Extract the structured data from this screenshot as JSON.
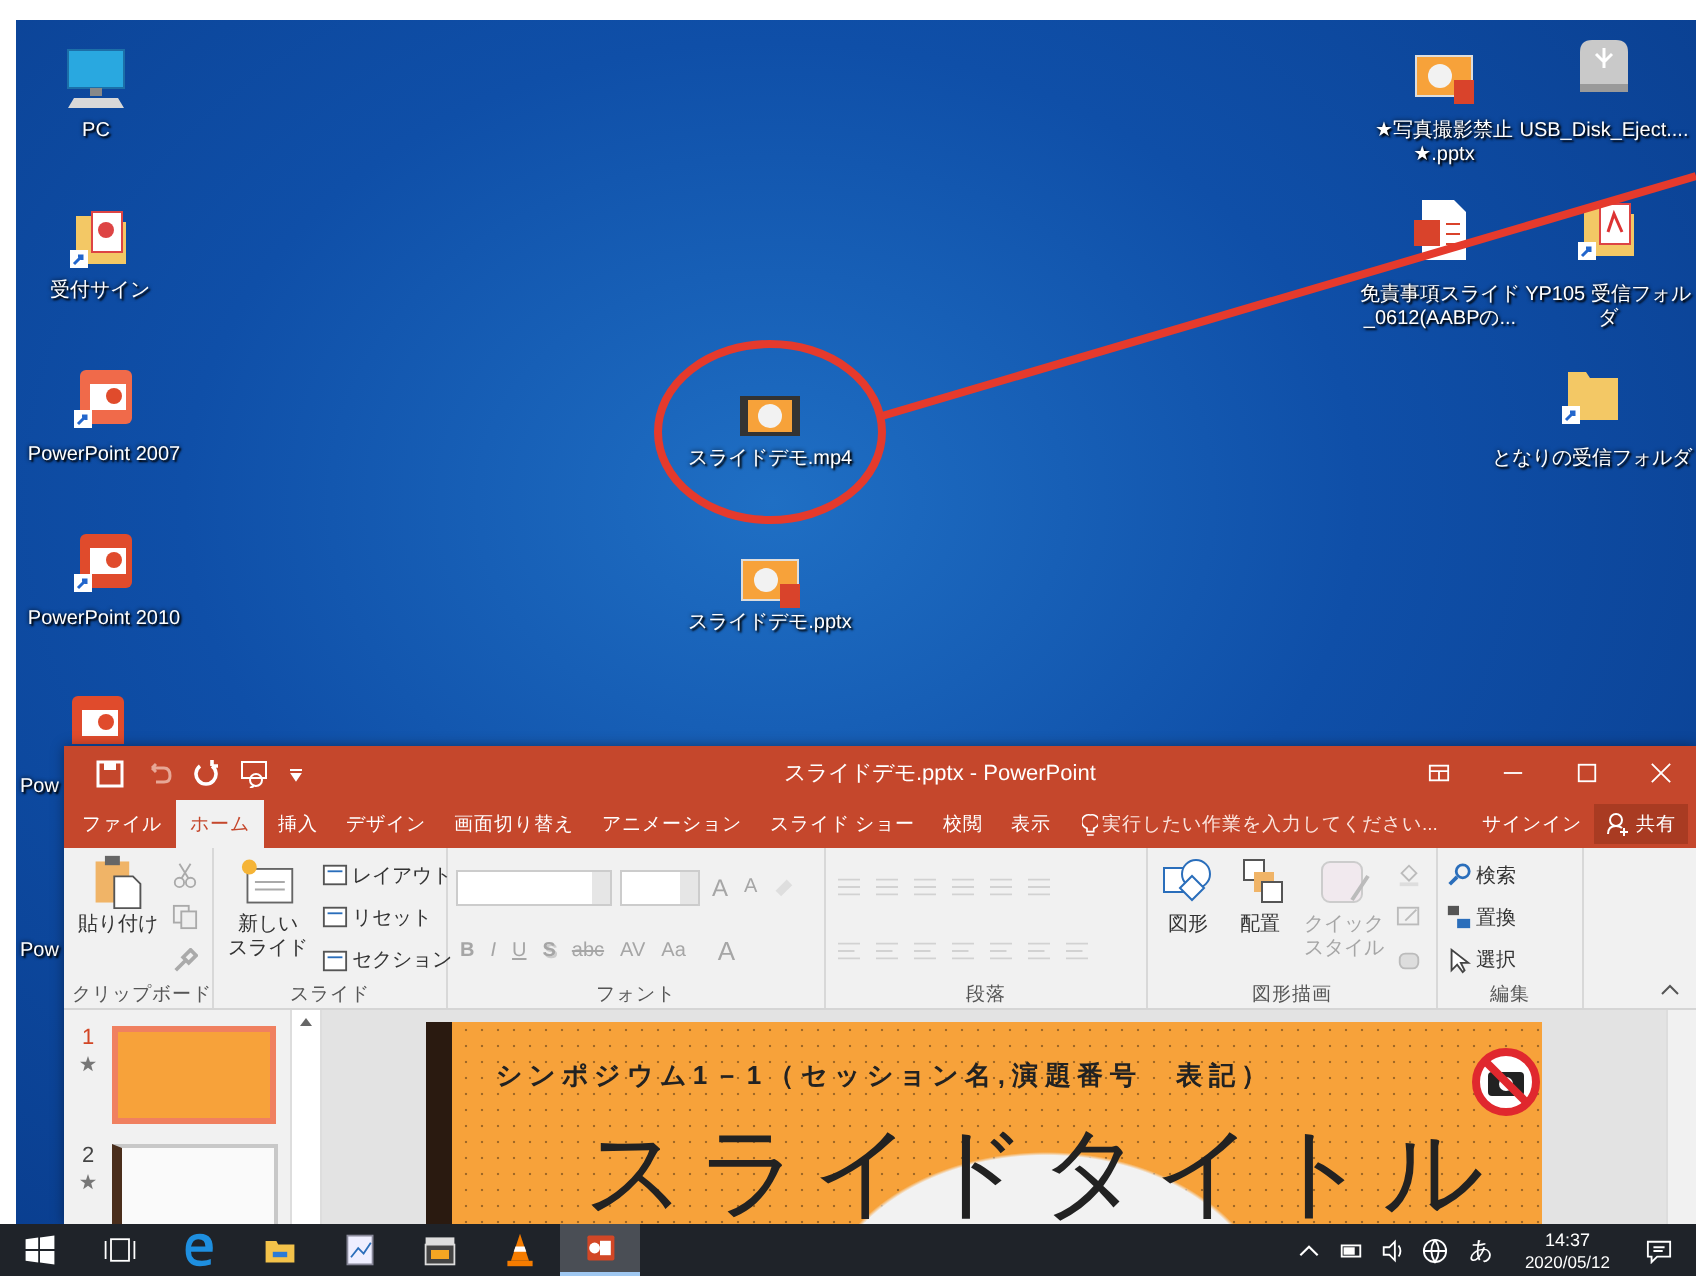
{
  "desktop": {
    "icons": [
      {
        "label": "PC",
        "kind": "monitor"
      },
      {
        "label": "受付サイン",
        "kind": "shortcut-folder"
      },
      {
        "label": "PowerPoint 2007",
        "kind": "app-2007"
      },
      {
        "label": "PowerPoint 2010",
        "kind": "app-2010"
      },
      {
        "label": "Pow",
        "kind": "app"
      },
      {
        "label": "Pow",
        "kind": "label"
      },
      {
        "label": "スライドデモ.mp4",
        "kind": "video"
      },
      {
        "label": "スライドデモ.pptx",
        "kind": "pptx"
      },
      {
        "label": "★写真撮影禁止★.pptx",
        "kind": "pptx"
      },
      {
        "label": "USB_Disk_Eject....",
        "kind": "usb"
      },
      {
        "label": "免責事項スライド_0612(AABPの...",
        "kind": "document"
      },
      {
        "label": "YP105 受信フォルダ",
        "kind": "pdf-folder"
      },
      {
        "label": "となりの受信フォルダ",
        "kind": "folder"
      }
    ]
  },
  "window": {
    "title": "スライドデモ.pptx - PowerPoint",
    "tabs": [
      {
        "label": "ファイル",
        "selected": false
      },
      {
        "label": "ホーム",
        "selected": true
      },
      {
        "label": "挿入",
        "selected": false
      },
      {
        "label": "デザイン",
        "selected": false
      },
      {
        "label": "画面切り替え",
        "selected": false
      },
      {
        "label": "アニメーション",
        "selected": false
      },
      {
        "label": "スライド ショー",
        "selected": false
      },
      {
        "label": "校閲",
        "selected": false
      },
      {
        "label": "表示",
        "selected": false
      }
    ],
    "tell_me": {
      "placeholder": "実行したい作業を入力してください..."
    },
    "sign_in": "サインイン",
    "share": "共有",
    "ribbon": [
      {
        "kind": "clipboard",
        "label": "クリップボード",
        "disabled": false,
        "paste": "貼り付け"
      },
      {
        "kind": "slides",
        "label": "スライド",
        "disabled": false,
        "new_slide": [
          "新しい",
          "スライド"
        ],
        "commands": [
          "レイアウト",
          "リセット",
          "セクション"
        ]
      },
      {
        "kind": "font",
        "label": "フォント",
        "disabled": true,
        "size_buttons": [
          "A",
          "A"
        ],
        "styles": [
          "B",
          "I",
          "U",
          "S",
          "abc",
          "AV",
          "Aa",
          "A"
        ]
      },
      {
        "kind": "paragraph",
        "label": "段落",
        "disabled": true
      },
      {
        "kind": "drawing",
        "label": "図形描画",
        "disabled": false,
        "commands": [
          {
            "lines": [
              "図形"
            ],
            "disabled": false
          },
          {
            "lines": [
              "配置"
            ],
            "disabled": false
          },
          {
            "lines": [
              "クイック",
              "スタイル"
            ],
            "disabled": true
          }
        ]
      },
      {
        "kind": "editing",
        "label": "編集",
        "disabled": false,
        "commands": [
          "検索",
          "置換",
          "選択"
        ]
      }
    ],
    "thumbnails": [
      {
        "number": "1",
        "selected": true
      },
      {
        "number": "2",
        "selected": false
      }
    ],
    "slide": {
      "header": "シンポジウム1－1（セッション名,演題番号　表記）",
      "title": "スライドタイトル"
    }
  },
  "taskbar": {
    "apps": [
      {
        "kind": "start",
        "selected": false
      },
      {
        "kind": "task-view",
        "selected": false
      },
      {
        "kind": "browser",
        "selected": false
      },
      {
        "kind": "explorer",
        "selected": false
      },
      {
        "kind": "chart-doc",
        "selected": false
      },
      {
        "kind": "clapper",
        "selected": false
      },
      {
        "kind": "cone",
        "selected": false
      },
      {
        "kind": "powerpoint",
        "selected": true
      }
    ],
    "ime": "あ",
    "time": "14:37",
    "date": "2020/05/12"
  }
}
